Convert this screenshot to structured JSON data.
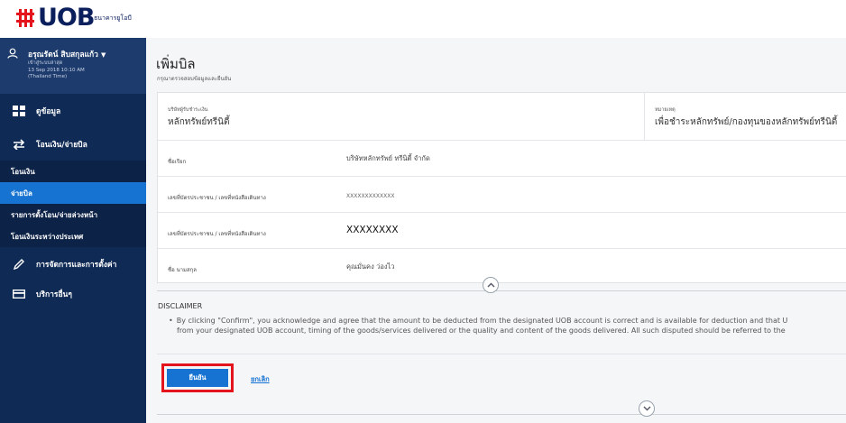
{
  "brand": {
    "name": "UOB",
    "thai": "ธนาคารยูโอบี",
    "color": "#0b1f5c",
    "mark_color": "#e3141b"
  },
  "user": {
    "name": "อรุณรัตน์ สิบสกุลแก้ว",
    "line1": "เข้าสู่ระบบล่าสุด",
    "line2": "13 Sep 2018 10:10 AM",
    "line3": "(Thailand Time)",
    "icon": "user-icon"
  },
  "sidebar": {
    "items": [
      {
        "label": "ดูข้อมูล",
        "icon": "grid-icon"
      },
      {
        "label": "โอนเงิน/จ่ายบิล",
        "icon": "transfer-icon"
      }
    ],
    "sub": [
      {
        "label": "โอนเงิน"
      },
      {
        "label": "จ่ายบิล"
      },
      {
        "label": "รายการตั้งโอน/จ่ายล่วงหน้า"
      },
      {
        "label": "โอนเงินระหว่างประเทศ"
      }
    ],
    "bottom": [
      {
        "label": "การจัดการและการตั้งค่า",
        "icon": "pencil-icon"
      },
      {
        "label": "บริการอื่นๆ",
        "icon": "card-icon"
      }
    ]
  },
  "page": {
    "title": "เพิ่มบิล",
    "subtitle": "กรุณาตรวจสอบข้อมูลและยืนยัน"
  },
  "biller": {
    "company_label": "บริษัทผู้รับชำระเงิน",
    "company_value": "หลักทรัพย์ทรีนิตี้",
    "note_label": "หมายเหตุ",
    "note_value": "เพื่อชำระหลักทรัพย์/กองทุนของหลักทรัพย์ทรีนิตี้"
  },
  "rows": [
    {
      "key": "ชื่อเรียก",
      "value": "บริษัทหลักทรัพย์ ทรีนิตี้ จำกัด"
    },
    {
      "key": "เลขที่บัตรประชาชน / เลขที่หนังสือเดินทาง",
      "value": "XXXXXXXXXXXXX"
    },
    {
      "key": "เลขที่บัตรประชาชน / เลขที่หนังสือเดินทาง",
      "value": "XXXXXXXX"
    },
    {
      "key": "ชื่อ นามสกุล",
      "value": "คุณมั่นคง ว่องไว"
    }
  ],
  "disclaimer": {
    "title": "DISCLAIMER",
    "line1": "By clicking \"Confirm\", you acknowledge and agree that the amount to be deducted from the designated UOB account is correct and is available for deduction and that U",
    "line2": "from your designated UOB account, timing of the goods/services delivered or the quality and content of the goods delivered. All such disputed should be referred to the"
  },
  "actions": {
    "confirm": "ยืนยัน",
    "cancel": "ยกเลิก"
  },
  "colors": {
    "sidebar": "#0f2a55",
    "accent": "#1673d2",
    "highlight": "#e3141b"
  }
}
